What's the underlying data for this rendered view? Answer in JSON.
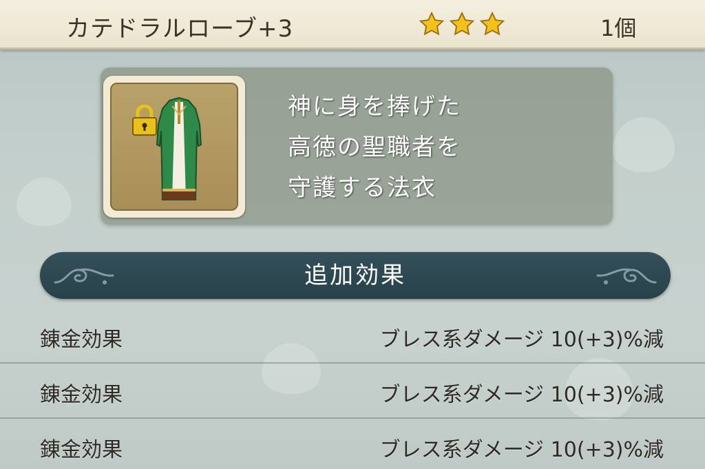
{
  "item": {
    "name": "カテドラルローブ+3",
    "stars": 3,
    "count": "1個",
    "icon": "robe-icon",
    "locked": true,
    "description": [
      "神に身を捧げた",
      "高徳の聖職者を",
      "守護する法衣"
    ]
  },
  "section": {
    "title": "追加効果"
  },
  "effects": [
    {
      "name": "錬金効果",
      "value": "ブレス系ダメージ  10(+3)%減"
    },
    {
      "name": "錬金効果",
      "value": "ブレス系ダメージ  10(+3)%減"
    },
    {
      "name": "錬金効果",
      "value": "ブレス系ダメージ  10(+3)%減"
    }
  ],
  "colors": {
    "star": "#f2c21b",
    "banner": "#2f4a53",
    "robe_green": "#2f8a4a",
    "lock": "#e8c21a"
  }
}
